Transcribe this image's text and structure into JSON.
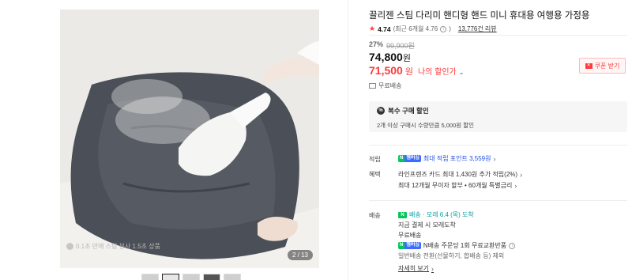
{
  "gallery": {
    "caption": "0.1초 만에 스팀 분사 1.5초 상품",
    "counter": "2 / 13",
    "thumbnail_count": 5
  },
  "product": {
    "title": "끌리젠 스팀 다리미 핸디형 핸드 미니 휴대용 여행용 가정용",
    "rating_score": "4.74",
    "rating_recent": "(최근 6개월 4.76",
    "rating_recent_close": ")",
    "review_count": "13,776건 리뷰",
    "discount_pct": "27%",
    "original_price": "99,900원",
    "price": "74,800",
    "price_unit": "원",
    "my_price": "71,500",
    "my_price_unit": "원",
    "my_price_label": "나의 할인가",
    "coupon_label": "쿠폰 받기",
    "shipping_label": "무료배송"
  },
  "multi_buy": {
    "title": "복수 구매 할인",
    "desc": "2개 이상 구매시 수량만큼 5,000원 할인"
  },
  "points": {
    "label": "적립",
    "npay_n": "N",
    "npay_m": "멤버십",
    "text": "최대 적립 포인트 3,559원"
  },
  "benefits": {
    "label": "혜택",
    "line1": "라인프렌즈 카드 최대 1,430원 추가 적립(2%)",
    "line2": "최대 12개월 무이자 할부 • 60개월 특별금리"
  },
  "delivery": {
    "label": "배송",
    "badge": "N",
    "arrival": "배송 · 모레 6.4 (목) 도착",
    "line1": "지금 결제 시 모레도착",
    "line2": "무료배송",
    "npay_n": "N",
    "npay_m": "멤버십",
    "line3": "N배송 주문당 1회 무료교환반품",
    "line4": "일반배송 전환(선물하기, 합배송 등) 제외",
    "more": "자세히 보기"
  },
  "colors": {
    "accent_red": "#ff3a3a",
    "npay_green": "#03c75a",
    "link_blue": "#1f4de3"
  }
}
